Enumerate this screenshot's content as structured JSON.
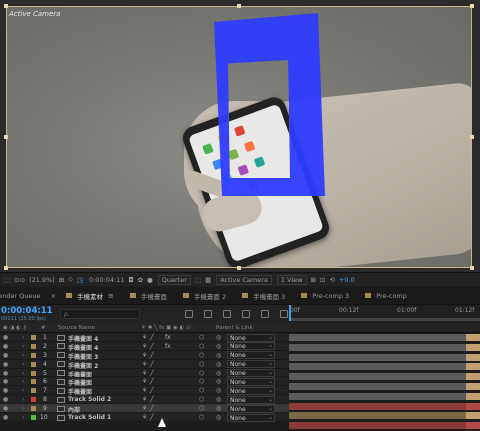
{
  "viewer": {
    "camera_label": "Active Camera"
  },
  "viewer_toolbar": {
    "zoom": "(21.9%)",
    "timecode": "0:00:04:11",
    "resolution": "Quarter",
    "camera": "Active Camera",
    "views": "1 View",
    "exposure": "+0.0"
  },
  "tabs": [
    {
      "label": "Render Queue",
      "swatch": false
    },
    {
      "label": "手機素材",
      "swatch": true,
      "active": true
    },
    {
      "label": "手機畫面",
      "swatch": true
    },
    {
      "label": "手機畫面 2",
      "swatch": true
    },
    {
      "label": "手機畫面 3",
      "swatch": true
    },
    {
      "label": "Pre-comp 3",
      "swatch": true
    },
    {
      "label": "Pre-comp",
      "swatch": true
    }
  ],
  "timeline": {
    "timecode": "0:00:04:11",
    "fps": "00111 (25.00 fps)",
    "search_placeholder": "ρ.",
    "ruler": [
      "00f",
      "00:12f",
      "01:00f",
      "01:12f"
    ]
  },
  "columns": {
    "num": "#",
    "source": "Source Name",
    "parent": "Parent & Link"
  },
  "layers": [
    {
      "num": "1",
      "name": "手機畫面 4",
      "color": "#a88b53",
      "fx": true,
      "bar": "#5b5b5b"
    },
    {
      "num": "2",
      "name": "手機畫面 4",
      "color": "#a88b53",
      "fx": true,
      "bar": "#5b5b5b"
    },
    {
      "num": "3",
      "name": "手機畫面 3",
      "color": "#a88b53",
      "fx": false,
      "bar": "#5b5b5b"
    },
    {
      "num": "4",
      "name": "手機畫面 2",
      "color": "#a88b53",
      "fx": false,
      "bar": "#5b5b5b"
    },
    {
      "num": "5",
      "name": "手機畫面",
      "color": "#a88b53",
      "fx": false,
      "bar": "#5b5b5b"
    },
    {
      "num": "6",
      "name": "手機畫面",
      "color": "#a88b53",
      "fx": false,
      "bar": "#5b5b5b"
    },
    {
      "num": "7",
      "name": "手機畫面",
      "color": "#a88b53",
      "fx": false,
      "bar": "#5b5b5b"
    },
    {
      "num": "8",
      "name": "Track Solid 2",
      "color": "#d23a3a",
      "fx": false,
      "bar": "#8b3a3a"
    },
    {
      "num": "9",
      "name": "內部",
      "color": "#a88b53",
      "fx": false,
      "bar": "#7a6a4a",
      "highlight": true
    },
    {
      "num": "10",
      "name": "Track Solid 1",
      "color": "#4fbf3a",
      "fx": false,
      "bar": "#8b3a3a"
    }
  ],
  "parent_value": "None",
  "colors": {
    "accent": "#3ea5ff",
    "shape_blue": "#2e3cff"
  }
}
